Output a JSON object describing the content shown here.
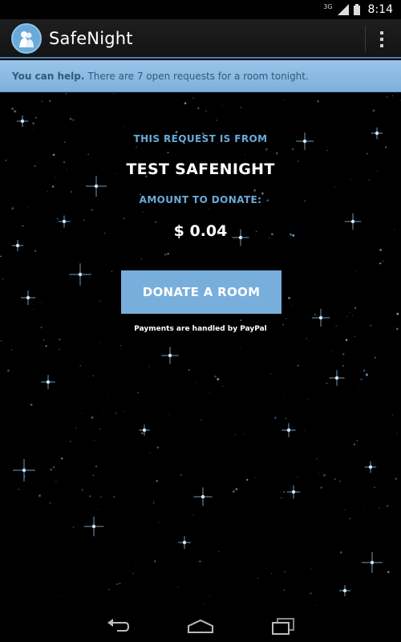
{
  "status_bar": {
    "network": "3G",
    "time": "8:14"
  },
  "action_bar": {
    "title": "SafeNight",
    "logo_icon": "safenight-logo-icon",
    "overflow_icon": "overflow-menu-icon"
  },
  "banner": {
    "bold": "You can help.",
    "text": "There are 7 open requests for a room tonight."
  },
  "request": {
    "from_label": "THIS REQUEST IS FROM",
    "requester": "TEST SAFENIGHT",
    "amount_label": "AMOUNT TO DONATE:",
    "amount": "$ 0.04"
  },
  "donate_button": {
    "label": "DONATE A ROOM"
  },
  "payment_note": "Payments are handled by PayPal",
  "nav_bar": {
    "back_icon": "back-icon",
    "home_icon": "home-icon",
    "recents_icon": "recents-icon"
  },
  "colors": {
    "accent": "#6aaad8",
    "banner": "#8bbce4",
    "button": "#78aedb",
    "background": "#000000"
  }
}
